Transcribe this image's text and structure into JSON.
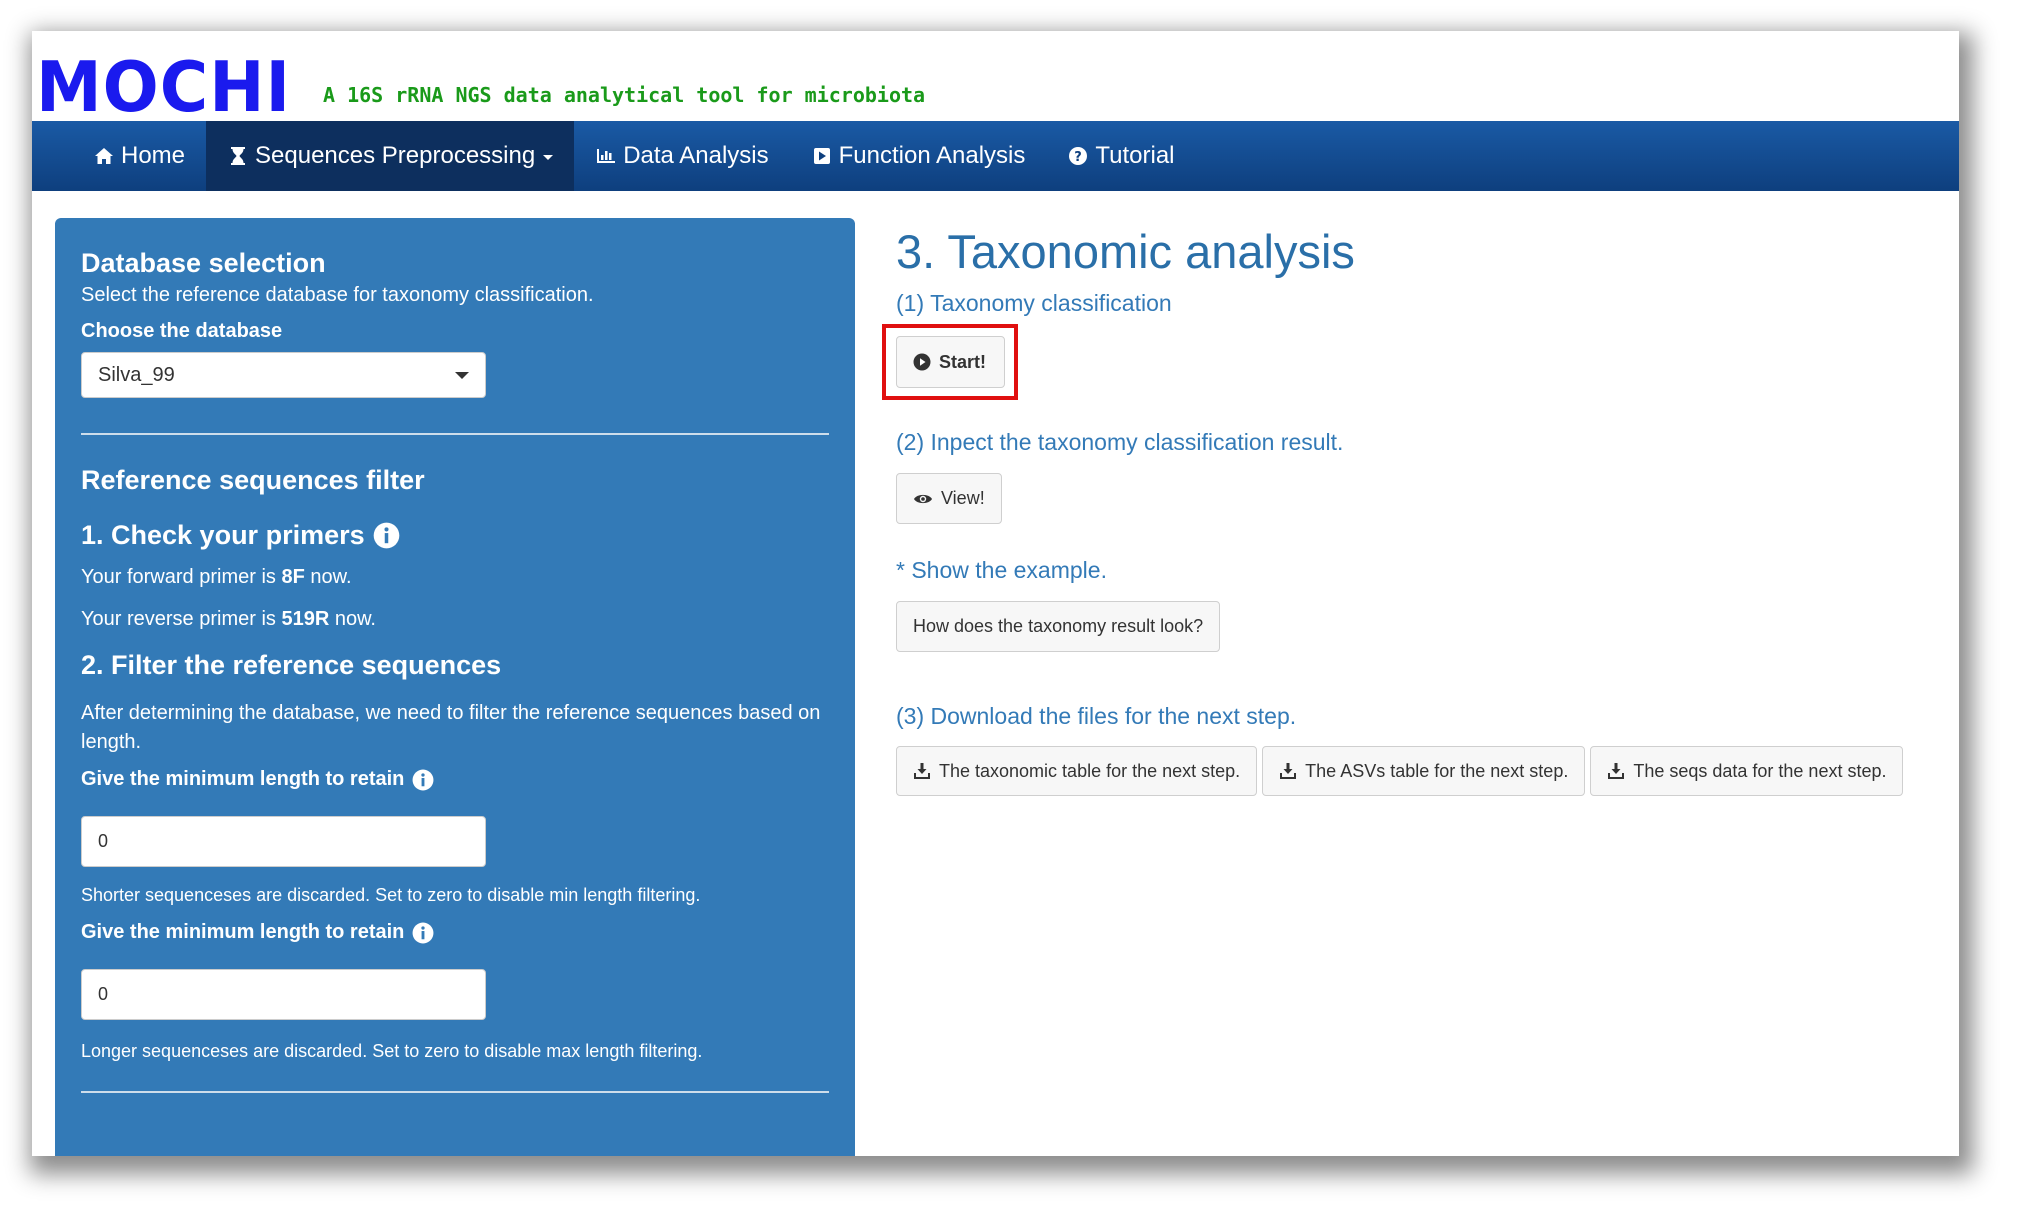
{
  "header": {
    "logo": "MOCHI",
    "tagline": "A 16S rRNA NGS data analytical tool for microbiota"
  },
  "nav": {
    "items": [
      {
        "label": "Home",
        "icon": "home-icon"
      },
      {
        "label": "Sequences Preprocessing",
        "icon": "hourglass-icon"
      },
      {
        "label": "Data Analysis",
        "icon": "bar-chart-icon"
      },
      {
        "label": "Function Analysis",
        "icon": "play-icon"
      },
      {
        "label": "Tutorial",
        "icon": "question-circle-icon"
      }
    ]
  },
  "sidebar": {
    "db_title": "Database selection",
    "db_desc": "Select the reference database for taxonomy classification.",
    "db_label": "Choose the database",
    "db_value": "Silva_99",
    "filter_title": "Reference sequences filter",
    "check_title": "1. Check your primers",
    "forward_prefix": "Your forward primer is ",
    "forward_value": "8F",
    "forward_suffix": " now.",
    "reverse_prefix": "Your reverse primer is ",
    "reverse_value": "519R",
    "reverse_suffix": " now.",
    "filter_step_title": "2. Filter the reference sequences",
    "filter_desc": "After determining the database, we need to filter the reference sequences based on length.",
    "min_label": "Give the minimum length to retain",
    "min_value": "0",
    "min_help": "Shorter sequenceses are discarded. Set to zero to disable min length filtering.",
    "max_label": "Give the minimum length to retain",
    "max_value": "0",
    "max_help": "Longer sequenceses are discarded. Set to zero to disable max length filtering."
  },
  "main": {
    "title": "3. Taxonomic analysis",
    "step1": "(1) Taxonomy classification",
    "start_label": "Start!",
    "step2": "(2) Inpect the taxonomy classification result.",
    "view_label": "View!",
    "example": "* Show the example.",
    "example_btn": "How does the taxonomy result look?",
    "step3": "(3) Download the files for the next step.",
    "downloads": [
      "The taxonomic table for the next step.",
      "The ASVs table for the next step.",
      "The seqs data for the next step."
    ]
  },
  "colors": {
    "navbar": "#0e3f7e",
    "sidebar": "#337ab7",
    "link": "#337ab7",
    "logo": "#1a1aee",
    "tagline": "#1a9a1a",
    "highlight": "#e01010"
  }
}
